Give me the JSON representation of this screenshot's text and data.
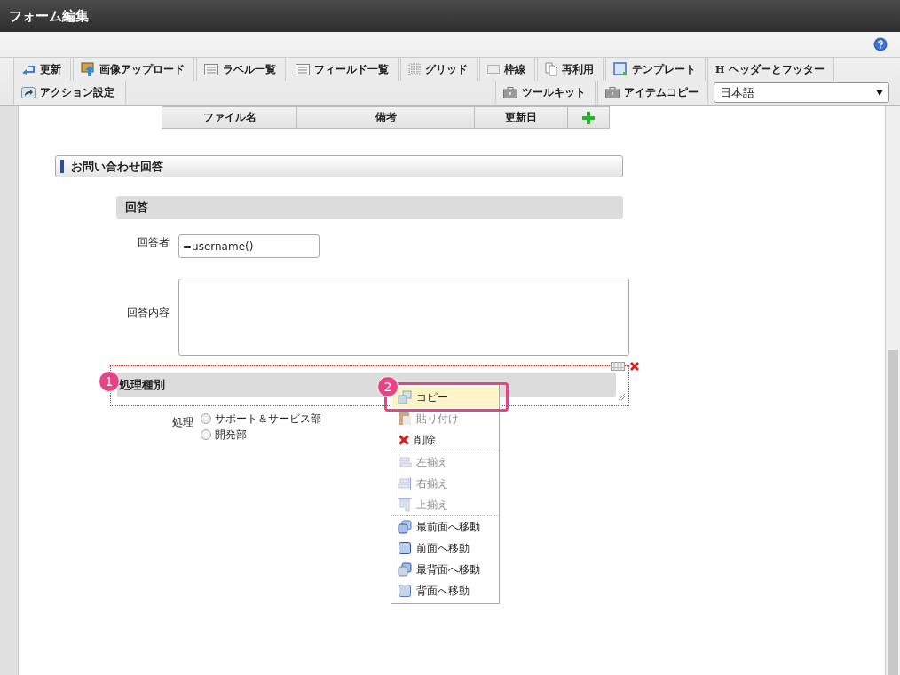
{
  "window": {
    "title": "フォーム編集"
  },
  "toolbar": {
    "tabs": [
      {
        "label": "更新"
      },
      {
        "label": "画像アップロード"
      },
      {
        "label": "ラベル一覧"
      },
      {
        "label": "フィールド一覧"
      },
      {
        "label": "グリッド"
      },
      {
        "label": "枠線"
      },
      {
        "label": "再利用"
      },
      {
        "label": "テンプレート"
      },
      {
        "label": "ヘッダーとフッター",
        "icon_text": "H"
      }
    ],
    "second_row_left": [
      {
        "label": "アクション設定"
      }
    ],
    "second_row_right": [
      {
        "label": "ツールキット"
      },
      {
        "label": "アイテムコピー"
      }
    ],
    "language": {
      "value": "日本語"
    }
  },
  "canvas": {
    "file_table": {
      "columns": [
        "ファイル名",
        "備考",
        "更新日"
      ]
    },
    "section_title": "お問い合わせ回答",
    "subsection_title": "回答",
    "fields": [
      {
        "kind": "input",
        "label": "回答者",
        "value": "=username()"
      },
      {
        "kind": "textarea",
        "label": "回答内容"
      }
    ],
    "selected_header": {
      "title": "処理種別",
      "callout": "1"
    },
    "radio_group": {
      "label": "処理",
      "options": [
        {
          "label": "サポート＆サービス部",
          "selected": false
        },
        {
          "label": "開発部",
          "selected": false
        }
      ]
    }
  },
  "context_menu": {
    "callout": "2",
    "groups": [
      [
        {
          "label": "コピー",
          "disabled": false,
          "selected": true
        },
        {
          "label": "貼り付け",
          "disabled": true,
          "selected": false
        },
        {
          "label": "削除",
          "disabled": false,
          "selected": false
        }
      ],
      [
        {
          "label": "左揃え",
          "disabled": true,
          "selected": false
        },
        {
          "label": "右揃え",
          "disabled": true,
          "selected": false
        },
        {
          "label": "上揃え",
          "disabled": true,
          "selected": false
        }
      ],
      [
        {
          "label": "最前面へ移動",
          "disabled": false,
          "selected": false
        },
        {
          "label": "前面へ移動",
          "disabled": false,
          "selected": false
        },
        {
          "label": "最背面へ移動",
          "disabled": false,
          "selected": false
        },
        {
          "label": "背面へ移動",
          "disabled": false,
          "selected": false
        }
      ]
    ]
  }
}
